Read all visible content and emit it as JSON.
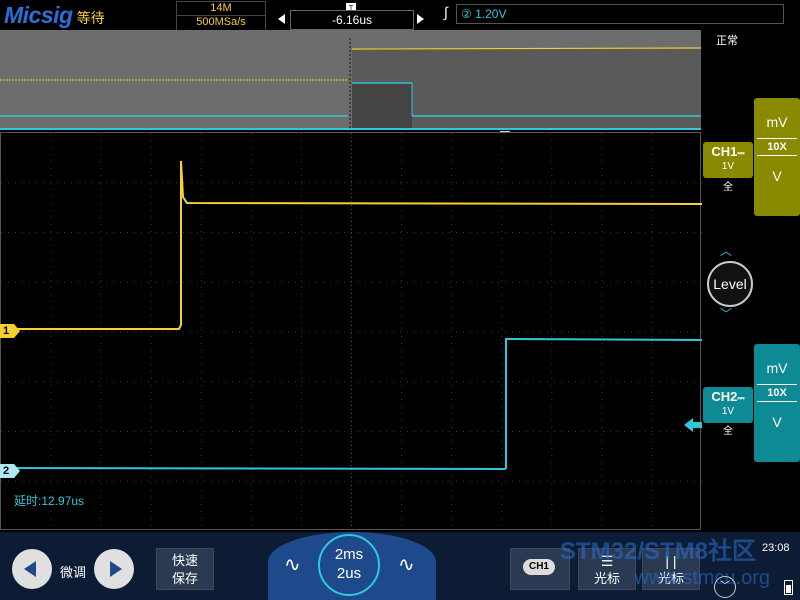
{
  "header": {
    "brand": "Micsig",
    "run_state": "等待",
    "memory_depth": "14M",
    "sample_rate": "500MSa/s",
    "time_offset": "-6.16us",
    "trigger_source": "②",
    "trigger_level": "1.20V"
  },
  "status": "正常",
  "trigger_marker": "T",
  "overlay": {
    "delay_label": "延时:12.97us"
  },
  "channels": [
    {
      "id": "1",
      "name": "CH1",
      "scale": "1V",
      "bandwidth": "全",
      "coupling_symbol": "⎓",
      "probe": "10X",
      "unit_top": "mV",
      "unit_bottom": "V",
      "color": "#f4d030",
      "panel_color": "#8a8a00"
    },
    {
      "id": "2",
      "name": "CH2",
      "scale": "1V",
      "bandwidth": "全",
      "coupling_symbol": "⎓",
      "probe": "10X",
      "unit_top": "mV",
      "unit_bottom": "V",
      "color": "#31c7d9",
      "panel_color": "#0e8a94"
    }
  ],
  "level_knob": {
    "label": "Level",
    "up_icon": "chevron-up-icon",
    "down_icon": "chevron-down-icon"
  },
  "bottom": {
    "fine_label": "微调",
    "quick_save": [
      "快速",
      "保存"
    ],
    "timebase_top": "2ms",
    "timebase_bottom": "2us",
    "ch1_badge": "CH1",
    "cursor1": "光标",
    "cursor2": "光标",
    "clock": "23:08",
    "watermark": "STM32/STM8社区",
    "watermark_url": "www.stmcu.org"
  },
  "colors": {
    "ch1": "#f4d030",
    "ch2": "#31c7d9",
    "grid": "#3c3c3c",
    "overview_bg": "#6d6d6d"
  }
}
